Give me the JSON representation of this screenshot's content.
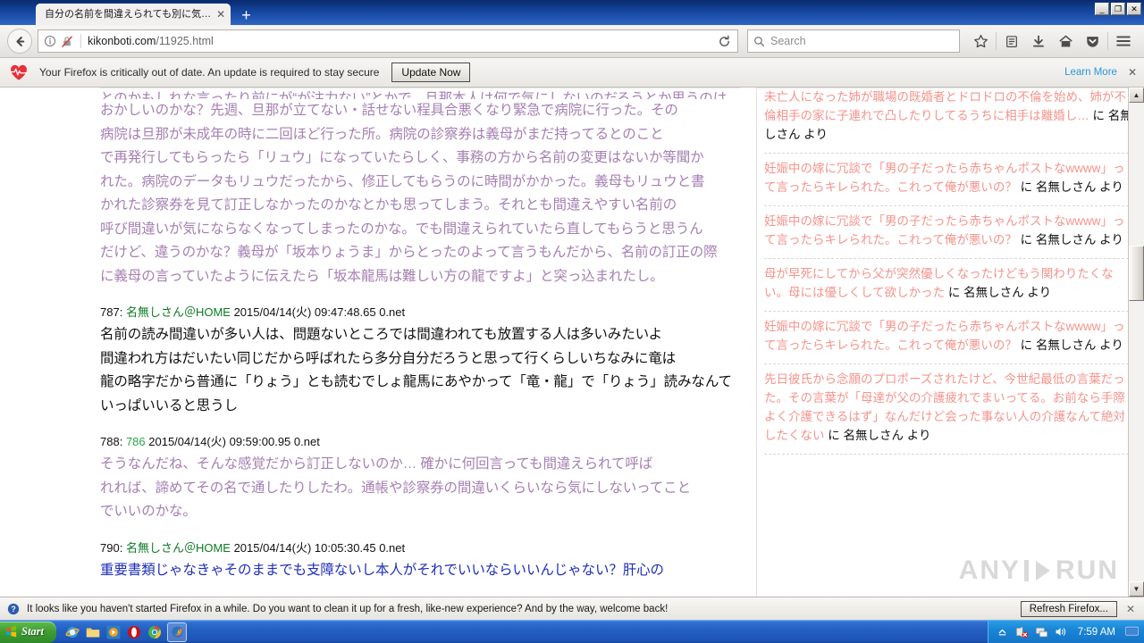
{
  "window": {
    "controls": {
      "minimize": "_",
      "maximize": "❐",
      "close": "✕"
    }
  },
  "tabs": {
    "items": [
      {
        "title": "自分の名前を間違えられても別に気…",
        "close_label": "✕"
      }
    ],
    "new_tab_label": "+"
  },
  "navbar": {
    "back_icon": "back-arrow-icon",
    "identity_icon": "info-icon",
    "insecure_icon": "crossed-lock-icon",
    "url_host": "kikonboti.com",
    "url_path": "/11925.html",
    "reload_icon": "reload-icon",
    "search_placeholder": "Search",
    "search_value": "",
    "icons": [
      "star-icon",
      "library-icon",
      "downloads-icon",
      "home-icon",
      "pocket-icon",
      "menu-icon"
    ]
  },
  "notification": {
    "icon": "heartbeat-icon",
    "message": "Your Firefox is critically out of date. An update is required to stay secure",
    "button_label": "Update Now",
    "learn_more_label": "Learn More",
    "close_label": "✕"
  },
  "page": {
    "quote": {
      "clipped_line": "とのかもしれな言ったり前にが“が注力ない”とかで、旦那本人は何で気にしないのだろうとか思うのは",
      "lines": [
        "おかしいのかな？先週、旦那が立てない・話せない程具合悪くなり緊急で病院に行った。その",
        "病院は旦那が未成年の時に二回ほど行った所。病院の診察券は義母がまだ持ってるとのこと",
        "で再発行してもらったら「リュウ」になっていたらしく、事務の方から名前の変更はないか等聞か",
        "れた。病院のデータもリュウだったから、修正してもらうのに時間がかかった。義母もリュウと書",
        "かれた診察券を見て訂正しなかったのかなとかも思ってしまう。それとも間違えやすい名前の",
        "呼び間違いが気にならなくなってしまったのかな。でも間違えられていたら直してもらうと思うん",
        "だけど、違うのかな？義母が「坂本りょうま」からとったのよって言うもんだから、名前の訂正の際",
        "に義母の言っていたように伝えたら「坂本龍馬は難しい方の龍ですよ」と突っ込まれたし。"
      ]
    },
    "posts": [
      {
        "number": "787:",
        "name": "名無しさん＠HOME",
        "name_is_ref": false,
        "date": "2015/04/14(火) 09:47:48.65 0.net",
        "body_color": "black",
        "indent": false,
        "body_lines": [
          "名前の読み間違いが多い人は、問題ないところでは間違われても放置する人は多いみたいよ",
          "間違われ方はだいたい同じだから呼ばれたら多分自分だろうと思って行くらしいちなみに竜は",
          "龍の略字だから普通に「りょう」とも読むでしょ龍馬にあやかって「竜・龍」で「りょう」読みなんて",
          "いっぱいいると思うし"
        ]
      },
      {
        "number": "788:",
        "name": "786",
        "name_is_ref": true,
        "date": "2015/04/14(火) 09:59:00.95 0.net",
        "body_color": "purple",
        "indent": true,
        "body_lines": [
          "そうなんだね、そんな感覚だから訂正しないのか… 確かに何回言っても間違えられて呼ば",
          "れれば、諦めてその名で通したりしたわ。通帳や診察券の間違いくらいなら気にしないってこと",
          "でいいのかな。"
        ]
      },
      {
        "number": "790:",
        "name": "名無しさん＠HOME",
        "name_is_ref": false,
        "date": "2015/04/14(火) 10:05:30.45 0.net",
        "body_color": "blue",
        "indent": false,
        "body_lines": [
          "重要書類じゃなきゃそのままでも支障ないし本人がそれでいいならいいんじゃない？肝心の"
        ]
      }
    ]
  },
  "sidebar": {
    "items": [
      {
        "link": "未亡人になった姉が職場の既婚者とドロドロの不倫を始め、姉が不倫相手の家に子連れで凸したりしてるうちに相手は離婚し…",
        "by": "に 名無しさん より"
      },
      {
        "link": "妊娠中の嫁に冗談で「男の子だったら赤ちゃんポストなwwww」って言ったらキレられた。これって俺が悪いの？",
        "by": "に 名無しさん より"
      },
      {
        "link": "妊娠中の嫁に冗談で「男の子だったら赤ちゃんポストなwwww」って言ったらキレられた。これって俺が悪いの？",
        "by": "に 名無しさん より"
      },
      {
        "link": "母が早死にしてから父が突然優しくなったけどもう関わりたくない。母には優しくして欲しかった",
        "by": "に 名無しさん より"
      },
      {
        "link": "妊娠中の嫁に冗談で「男の子だったら赤ちゃんポストなwwww」って言ったらキレられた。これって俺が悪いの？",
        "by": "に 名無しさん より"
      },
      {
        "link": "先日彼氏から念願のプロポーズされたけど、今世紀最低の言葉だった。その言葉が「母達が父の介護疲れでまいってる。お前なら手際よく介護できるはず」なんだけど会った事ない人の介護なんて絶対したくない",
        "by": "に 名無しさん より"
      }
    ]
  },
  "watermark": {
    "text_left": "ANY",
    "text_right": "RUN"
  },
  "bottom_notification": {
    "icon": "question-icon",
    "message": "It looks like you haven't started Firefox in a while. Do you want to clean it up for a fresh, like-new experience? And by the way, welcome back!",
    "button_label": "Refresh Firefox...",
    "close_label": "✕"
  },
  "taskbar": {
    "start_label": "Start",
    "quicklaunch": [
      "internet-explorer-icon",
      "folder-icon",
      "media-player-icon",
      "opera-icon",
      "chrome-icon",
      "firefox-icon"
    ],
    "tray_icons": [
      "chevron-up-icon",
      "network-blocked-icon",
      "computer-icon",
      "volume-icon"
    ],
    "clock": "7:59 AM",
    "show-desktop": "desktop-icon"
  },
  "scrollbar": {
    "up_label": "▲",
    "down_label": "▼"
  }
}
